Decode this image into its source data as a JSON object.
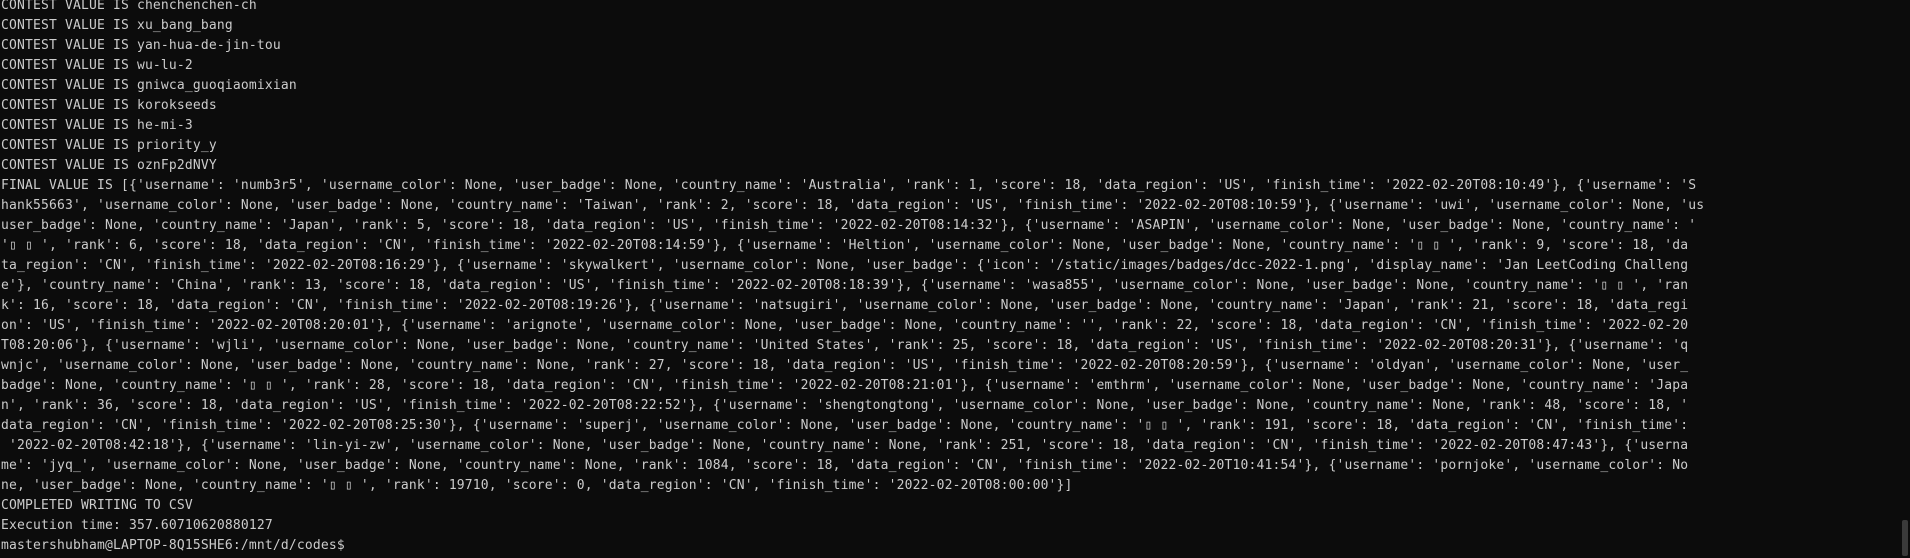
{
  "terminal": {
    "lines": [
      "CONTEST VALUE IS chenchenchen-ch",
      "CONTEST VALUE IS xu_bang_bang",
      "CONTEST VALUE IS yan-hua-de-jin-tou",
      "CONTEST VALUE IS wu-lu-2",
      "CONTEST VALUE IS gniwca_guoqiaomixian",
      "CONTEST VALUE IS korokseeds",
      "CONTEST VALUE IS he-mi-3",
      "CONTEST VALUE IS priority_y",
      "CONTEST VALUE IS oznFp2dNVY",
      "FINAL VALUE IS [{'username': 'numb3r5', 'username_color': None, 'user_badge': None, 'country_name': 'Australia', 'rank': 1, 'score': 18, 'data_region': 'US', 'finish_time': '2022-02-20T08:10:49'}, {'username': 'S",
      "hank55663', 'username_color': None, 'user_badge': None, 'country_name': 'Taiwan', 'rank': 2, 'score': 18, 'data_region': 'US', 'finish_time': '2022-02-20T08:10:59'}, {'username': 'uwi', 'username_color': None, 'us",
      "user_badge': None, 'country_name': 'Japan', 'rank': 5, 'score': 18, 'data_region': 'US', 'finish_time': '2022-02-20T08:14:32'}, {'username': 'ASAPIN', 'username_color': None, 'user_badge': None, 'country_name': '",
      "'▯ ▯ ', 'rank': 6, 'score': 18, 'data_region': 'CN', 'finish_time': '2022-02-20T08:14:59'}, {'username': 'Heltion', 'username_color': None, 'user_badge': None, 'country_name': '▯ ▯ ', 'rank': 9, 'score': 18, 'da",
      "ta_region': 'CN', 'finish_time': '2022-02-20T08:16:29'}, {'username': 'skywalkert', 'username_color': None, 'user_badge': {'icon': '/static/images/badges/dcc-2022-1.png', 'display_name': 'Jan LeetCoding Challeng",
      "e'}, 'country_name': 'China', 'rank': 13, 'score': 18, 'data_region': 'US', 'finish_time': '2022-02-20T08:18:39'}, {'username': 'wasa855', 'username_color': None, 'user_badge': None, 'country_name': '▯ ▯ ', 'ran",
      "k': 16, 'score': 18, 'data_region': 'CN', 'finish_time': '2022-02-20T08:19:26'}, {'username': 'natsugiri', 'username_color': None, 'user_badge': None, 'country_name': 'Japan', 'rank': 21, 'score': 18, 'data_regi",
      "on': 'US', 'finish_time': '2022-02-20T08:20:01'}, {'username': 'arignote', 'username_color': None, 'user_badge': None, 'country_name': '', 'rank': 22, 'score': 18, 'data_region': 'CN', 'finish_time': '2022-02-20",
      "T08:20:06'}, {'username': 'wjli', 'username_color': None, 'user_badge': None, 'country_name': 'United States', 'rank': 25, 'score': 18, 'data_region': 'US', 'finish_time': '2022-02-20T08:20:31'}, {'username': 'q",
      "wnjc', 'username_color': None, 'user_badge': None, 'country_name': None, 'rank': 27, 'score': 18, 'data_region': 'US', 'finish_time': '2022-02-20T08:20:59'}, {'username': 'oldyan', 'username_color': None, 'user_",
      "badge': None, 'country_name': '▯ ▯ ', 'rank': 28, 'score': 18, 'data_region': 'CN', 'finish_time': '2022-02-20T08:21:01'}, {'username': 'emthrm', 'username_color': None, 'user_badge': None, 'country_name': 'Japa",
      "n', 'rank': 36, 'score': 18, 'data_region': 'US', 'finish_time': '2022-02-20T08:22:52'}, {'username': 'shengtongtong', 'username_color': None, 'user_badge': None, 'country_name': None, 'rank': 48, 'score': 18, '",
      "data_region': 'CN', 'finish_time': '2022-02-20T08:25:30'}, {'username': 'superj', 'username_color': None, 'user_badge': None, 'country_name': '▯ ▯ ', 'rank': 191, 'score': 18, 'data_region': 'CN', 'finish_time':",
      " '2022-02-20T08:42:18'}, {'username': 'lin-yi-zw', 'username_color': None, 'user_badge': None, 'country_name': None, 'rank': 251, 'score': 18, 'data_region': 'CN', 'finish_time': '2022-02-20T08:47:43'}, {'userna",
      "me': 'jyq_', 'username_color': None, 'user_badge': None, 'country_name': None, 'rank': 1084, 'score': 18, 'data_region': 'CN', 'finish_time': '2022-02-20T10:41:54'}, {'username': 'pornjoke', 'username_color': No",
      "ne, 'user_badge': None, 'country_name': '▯ ▯ ', 'rank': 19710, 'score': 0, 'data_region': 'CN', 'finish_time': '2022-02-20T08:00:00'}]",
      "COMPLETED WRITING TO CSV",
      "Execution time: 357.60710620880127"
    ],
    "prompt": "mastershubham@LAPTOP-8Q15SHE6:/mnt/d/codes$"
  }
}
